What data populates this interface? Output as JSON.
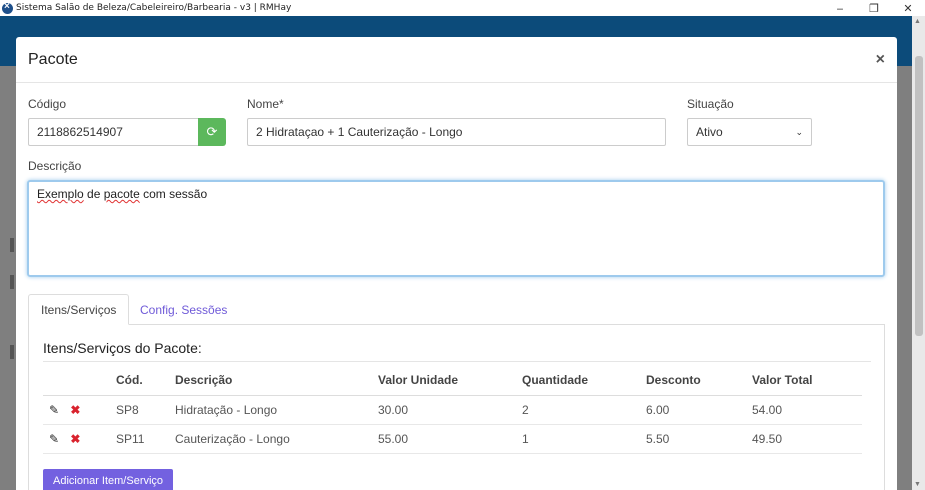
{
  "window": {
    "title": "Sistema Salão de Beleza/Cabeleireiro/Barbearia - v3 | RMHay",
    "minimize": "‒",
    "maximize": "❐",
    "close": "✕"
  },
  "modal": {
    "title": "Pacote",
    "close": "×",
    "fields": {
      "codigo_label": "Código",
      "codigo_value": "2118862514907",
      "nome_label": "Nome*",
      "nome_value": "2 Hidrataçao + 1 Cauterização - Longo",
      "situacao_label": "Situação",
      "situacao_value": "Ativo",
      "descricao_label": "Descrição",
      "descricao_word1": "Exemplo",
      "descricao_word2": "de",
      "descricao_word3": "pacote",
      "descricao_word4": "com sessão"
    },
    "tabs": [
      {
        "label": "Itens/Serviços",
        "active": true
      },
      {
        "label": "Config. Sessões",
        "active": false
      }
    ],
    "items_section": {
      "title": "Itens/Serviços do Pacote:",
      "columns": [
        "Cód.",
        "Descrição",
        "Valor Unidade",
        "Quantidade",
        "Desconto",
        "Valor Total"
      ],
      "rows": [
        {
          "cod": "SP8",
          "descricao": "Hidratação - Longo",
          "valor_unidade": "30.00",
          "quantidade": "2",
          "desconto": "6.00",
          "valor_total": "54.00"
        },
        {
          "cod": "SP11",
          "descricao": "Cauterização - Longo",
          "valor_unidade": "55.00",
          "quantidade": "1",
          "desconto": "5.50",
          "valor_total": "49.50"
        }
      ]
    },
    "add_button": "Adicionar Item/Serviço"
  },
  "colors": {
    "header_bg": "#0c4b7a",
    "refresh_btn": "#5cb85c",
    "add_btn": "#7361e0",
    "delete_icon": "#d9232e",
    "tab_link": "#6f5ad8"
  },
  "icons": {
    "refresh": "refresh-icon",
    "edit": "pencil-icon",
    "delete": "x-icon",
    "caret": "chevron-down-icon"
  }
}
